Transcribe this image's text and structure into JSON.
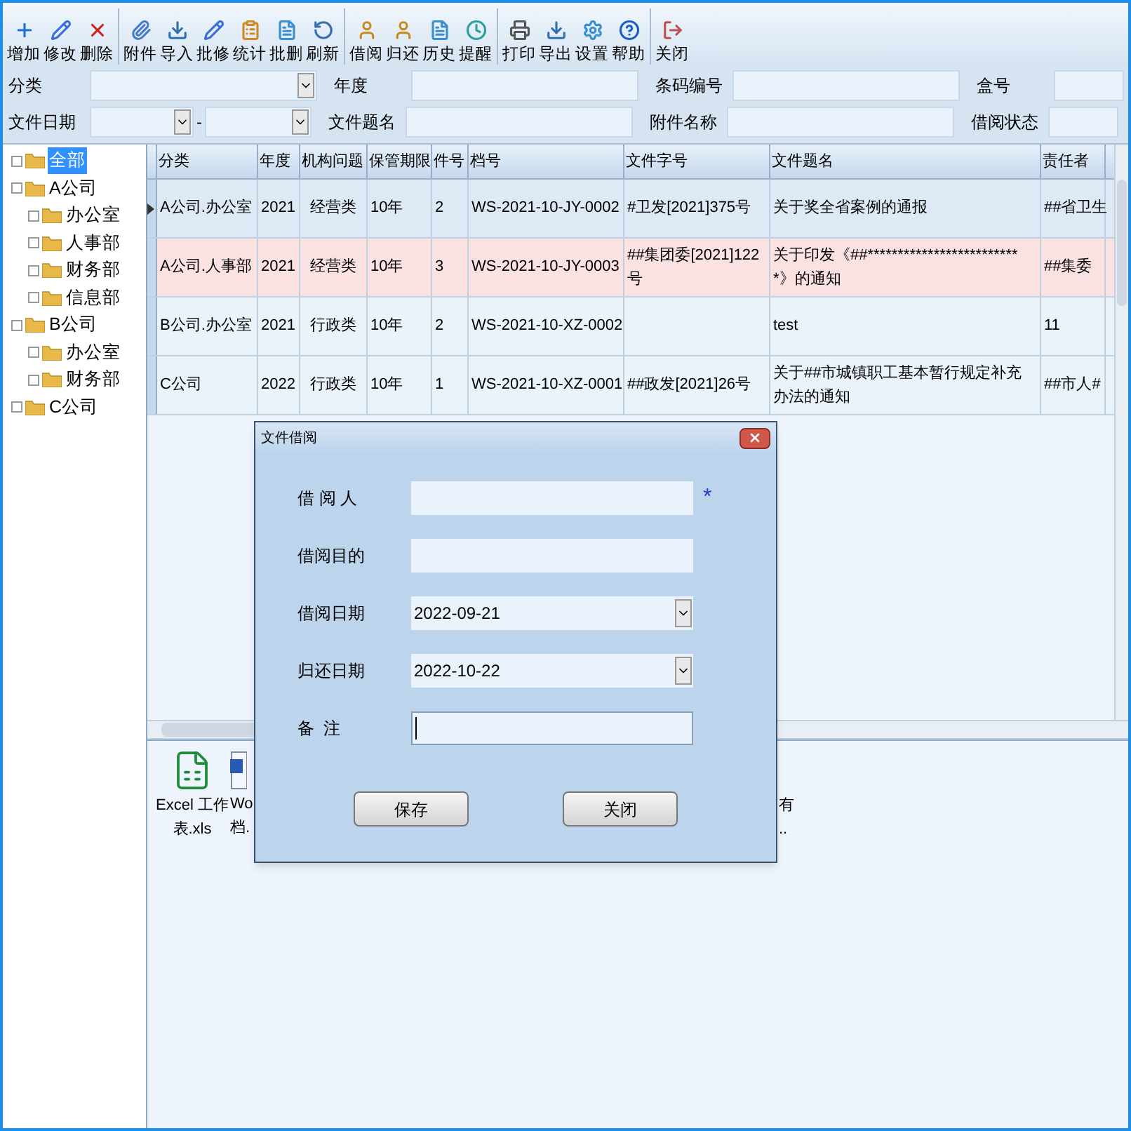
{
  "toolbar": [
    [
      {
        "label": "增加",
        "kind": "add"
      },
      {
        "label": "修改",
        "kind": "edit"
      },
      {
        "label": "删除",
        "kind": "delete"
      }
    ],
    [
      {
        "label": "附件",
        "kind": "clip"
      },
      {
        "label": "导入",
        "kind": "import"
      },
      {
        "label": "批修",
        "kind": "edit"
      },
      {
        "label": "统计",
        "kind": "stats"
      },
      {
        "label": "批删",
        "kind": "doc"
      },
      {
        "label": "刷新",
        "kind": "refresh"
      }
    ],
    [
      {
        "label": "借阅",
        "kind": "user"
      },
      {
        "label": "归还",
        "kind": "user"
      },
      {
        "label": "历史",
        "kind": "doc"
      },
      {
        "label": "提醒",
        "kind": "clock"
      }
    ],
    [
      {
        "label": "打印",
        "kind": "print"
      },
      {
        "label": "导出",
        "kind": "import"
      },
      {
        "label": "设置",
        "kind": "gear"
      },
      {
        "label": "帮助",
        "kind": "help"
      }
    ],
    [
      {
        "label": "关闭",
        "kind": "exit"
      }
    ]
  ],
  "filters": [
    [
      {
        "label": "分类",
        "kind": "combo"
      },
      {
        "label": "年度",
        "kind": "text"
      },
      {
        "label": "条码编号",
        "kind": "text"
      },
      {
        "label": "盒号",
        "kind": "text"
      }
    ],
    [
      {
        "label": "文件日期",
        "kind": "daterange",
        "separator": "-"
      },
      {
        "label": "文件题名",
        "kind": "text"
      },
      {
        "label": "附件名称",
        "kind": "text"
      },
      {
        "label": "借阅状态",
        "kind": "text"
      }
    ]
  ],
  "tree": [
    {
      "label": "全部",
      "selected": true
    },
    {
      "label": "A公司",
      "selected": false,
      "children": [
        {
          "label": "办公室",
          "selected": false
        },
        {
          "label": "人事部",
          "selected": false
        },
        {
          "label": "财务部",
          "selected": false
        },
        {
          "label": "信息部",
          "selected": false
        }
      ]
    },
    {
      "label": "B公司",
      "selected": false,
      "children": [
        {
          "label": "办公室",
          "selected": false
        },
        {
          "label": "财务部",
          "selected": false
        }
      ]
    },
    {
      "label": "C公司",
      "selected": false
    }
  ],
  "table": {
    "columns": [
      "分类",
      "年度",
      "机构问题",
      "保管期限",
      "件号",
      "档号",
      "文件字号",
      "文件题名",
      "责任者"
    ],
    "rows": [
      {
        "current": true,
        "highlighted": false,
        "cells": [
          "A公司.办公室",
          "2021",
          "经营类",
          "10年",
          "2",
          "WS-2021-10-JY-0002",
          "#卫发[2021]375号",
          "关于奖全省案例的通报",
          "##省卫生"
        ]
      },
      {
        "current": false,
        "highlighted": true,
        "cells": [
          "A公司.人事部",
          "2021",
          "经营类",
          "10年",
          "3",
          "WS-2021-10-JY-0003",
          "##集团委[2021]122号",
          "关于印发《##**************************》的通知",
          "##集委"
        ]
      },
      {
        "current": false,
        "highlighted": false,
        "cells": [
          "B公司.办公室",
          "2021",
          "行政类",
          "10年",
          "2",
          "WS-2021-10-XZ-0002",
          "",
          "test",
          "11"
        ]
      },
      {
        "current": false,
        "highlighted": false,
        "cells": [
          "C公司",
          "2022",
          "行政类",
          "10年",
          "1",
          "WS-2021-10-XZ-0001",
          "##政发[2021]26号",
          "关于##市城镇职工基本暂行规定补充办法的通知",
          "##市人#"
        ]
      }
    ]
  },
  "attachments": [
    {
      "kind": "excel",
      "lines": [
        "Excel 工作",
        "表.xls"
      ]
    },
    {
      "kind": "word",
      "lines": [
        "Wo",
        "档."
      ]
    },
    {
      "kind": "none",
      "lines": [
        "有",
        ".."
      ]
    }
  ],
  "dialog": {
    "title": "文件借阅",
    "fields": [
      {
        "label": "借 阅 人",
        "kind": "text",
        "required": true,
        "focused": false
      },
      {
        "label": "借阅目的",
        "kind": "text",
        "required": false,
        "focused": false
      },
      {
        "label": "借阅日期",
        "kind": "date",
        "value": "2022-09-21",
        "required": false,
        "focused": false
      },
      {
        "label": "归还日期",
        "kind": "date",
        "value": "2022-10-22",
        "required": false,
        "focused": false
      },
      {
        "label": "备  注",
        "kind": "text",
        "required": false,
        "focused": true
      }
    ],
    "required_mark": "*",
    "buttons": [
      "保存",
      "关闭"
    ]
  }
}
